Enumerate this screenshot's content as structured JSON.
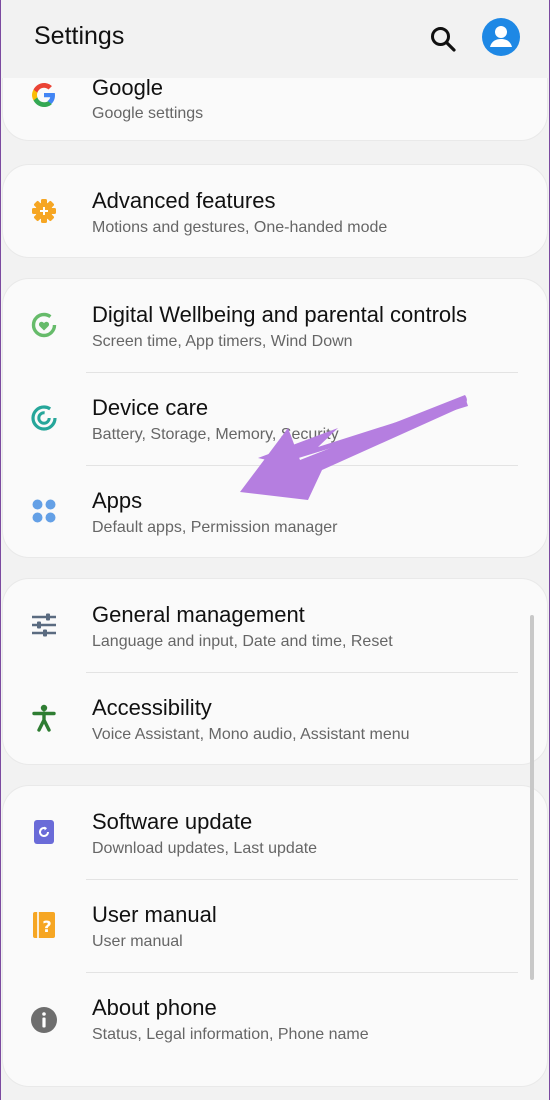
{
  "header": {
    "title": "Settings",
    "search_icon": "search-icon",
    "avatar_icon": "account-icon"
  },
  "groups": [
    {
      "items": [
        {
          "label": "Google",
          "sub": "Google settings",
          "icon": "google-icon"
        }
      ]
    },
    {
      "items": [
        {
          "label": "Advanced features",
          "sub": "Motions and gestures, One-handed mode",
          "icon": "gear-plus-icon",
          "color": "#f6a623"
        }
      ]
    },
    {
      "items": [
        {
          "label": "Digital Wellbeing and parental controls",
          "sub": "Screen time, App timers, Wind Down",
          "icon": "wellbeing-icon",
          "color": "#66bb6a"
        },
        {
          "label": "Device care",
          "sub": "Battery, Storage, Memory, Security",
          "icon": "device-care-icon",
          "color": "#26a69a"
        },
        {
          "label": "Apps",
          "sub": "Default apps, Permission manager",
          "icon": "apps-icon",
          "color": "#64a0e6"
        }
      ]
    },
    {
      "items": [
        {
          "label": "General management",
          "sub": "Language and input, Date and time, Reset",
          "icon": "sliders-icon",
          "color": "#5a6b80"
        },
        {
          "label": "Accessibility",
          "sub": "Voice Assistant, Mono audio, Assistant menu",
          "icon": "accessibility-icon",
          "color": "#2e7d32"
        }
      ]
    },
    {
      "items": [
        {
          "label": "Software update",
          "sub": "Download updates, Last update",
          "icon": "software-update-icon",
          "color": "#6a6bd8"
        },
        {
          "label": "User manual",
          "sub": "User manual",
          "icon": "user-manual-icon",
          "color": "#f6a623"
        },
        {
          "label": "About phone",
          "sub": "Status, Legal information, Phone name",
          "icon": "info-icon",
          "color": "#6e6e6e"
        }
      ]
    }
  ],
  "annotation": {
    "arrow_color": "#b57ee0"
  }
}
